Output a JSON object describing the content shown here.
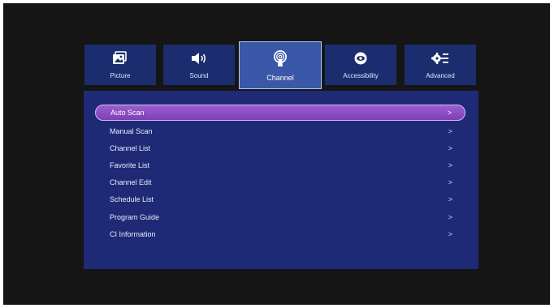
{
  "tabs": [
    {
      "label": "Picture",
      "icon": "picture-icon",
      "active": false
    },
    {
      "label": "Sound",
      "icon": "speaker-icon",
      "active": false
    },
    {
      "label": "Channel",
      "icon": "antenna-icon",
      "active": true
    },
    {
      "label": "Accessibility",
      "icon": "eye-icon",
      "active": false
    },
    {
      "label": "Advanced",
      "icon": "settings-list-icon",
      "active": false
    }
  ],
  "menu": {
    "selected_index": 0,
    "chevron": ">",
    "items": [
      {
        "label": "Auto Scan"
      },
      {
        "label": "Manual Scan"
      },
      {
        "label": "Channel List"
      },
      {
        "label": "Favorite List"
      },
      {
        "label": "Channel Edit"
      },
      {
        "label": "Schedule List"
      },
      {
        "label": "Program Guide"
      },
      {
        "label": "CI Information"
      }
    ]
  },
  "colors": {
    "screen_background": "#151515",
    "tab_background": "#1b2d6e",
    "tab_active_background": "#3b57a8",
    "panel_background": "#1e2a75",
    "selection_highlight": "#8a4cc4"
  }
}
